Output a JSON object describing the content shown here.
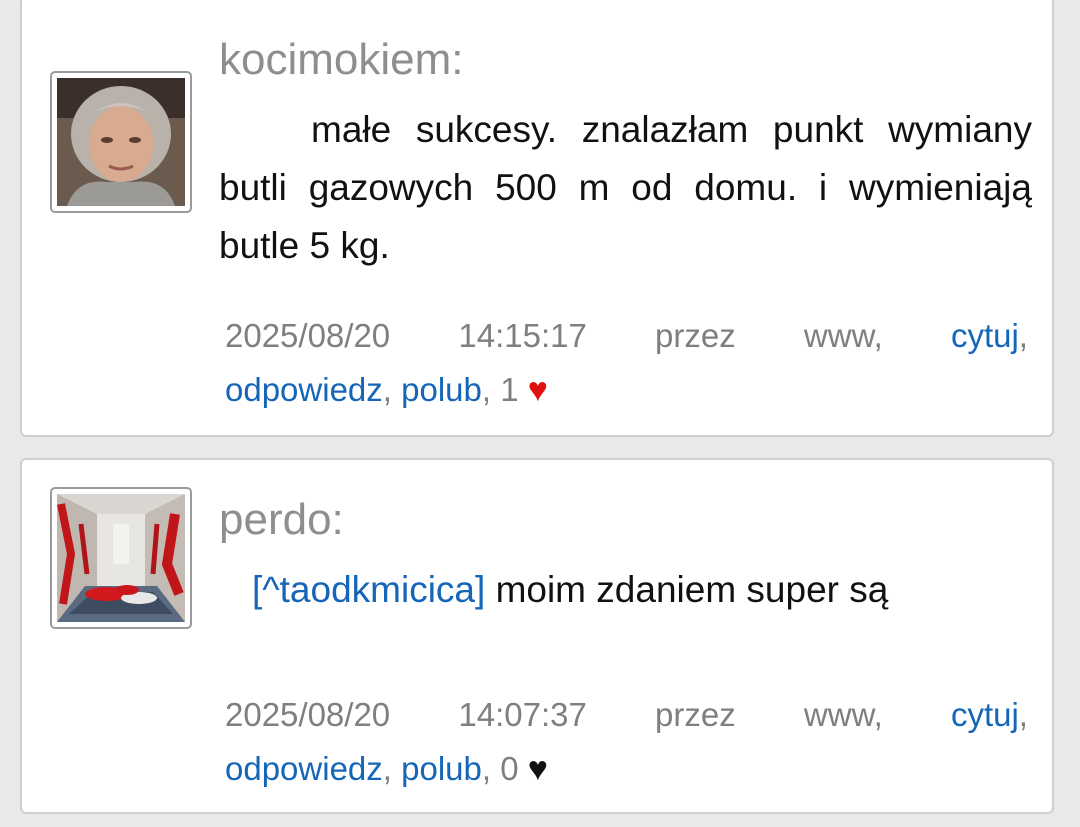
{
  "posts": [
    {
      "username": "kocimokiem:",
      "text": "małe sukcesy. znalazłam punkt wymiany butli gazowych 500 m od domu. i wymieniają butle 5 kg.",
      "date": "2025/08/20",
      "time": "14:15:17",
      "by": "przez",
      "source": "www,",
      "quote_label": "cytuj",
      "reply_label": "odpowiedz",
      "like_label": "polub",
      "likes": "1",
      "heart_color": "#e01010"
    },
    {
      "username": "perdo:",
      "mention": "[^taodkmicica]",
      "text": "moim zdaniem super są",
      "date": "2025/08/20",
      "time": "14:07:37",
      "by": "przez",
      "source": "www,",
      "quote_label": "cytuj",
      "reply_label": "odpowiedz",
      "like_label": "polub",
      "likes": "0",
      "heart_color": "#111111"
    }
  ],
  "punct": {
    "comma": ",",
    "comma_space": ", "
  },
  "icons": {
    "heart": "♥"
  }
}
